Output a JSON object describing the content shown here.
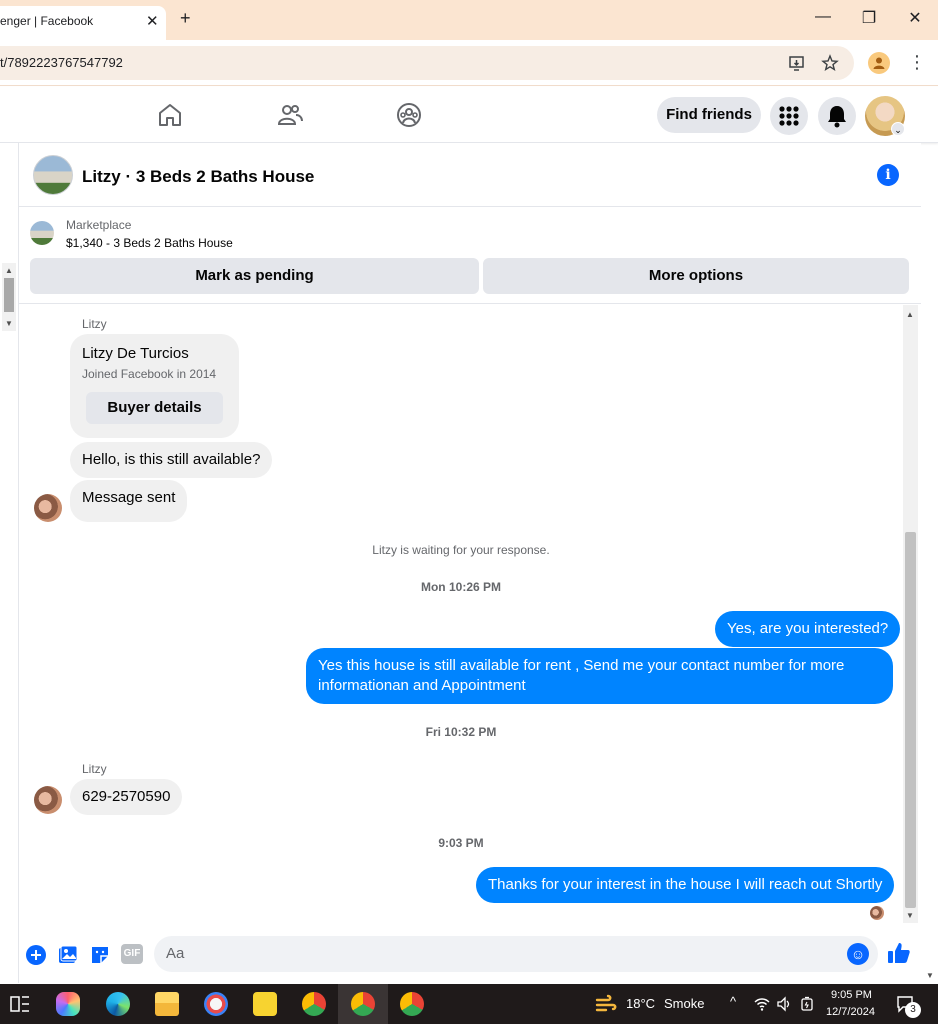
{
  "browser": {
    "tab_title": "enger | Facebook",
    "tab_close": "✕",
    "new_tab": "+",
    "url": "t/7892223767547792",
    "minimize": "—",
    "restore": "❐",
    "close": "✕"
  },
  "nav": {
    "find_friends": "Find friends"
  },
  "chat": {
    "title": "Litzy · 3 Beds 2 Baths House",
    "info": "i"
  },
  "marketplace": {
    "label": "Marketplace",
    "listing": "$1,340 - 3 Beds 2 Baths House",
    "mark_pending": "Mark as pending",
    "more_options": "More options"
  },
  "messages": {
    "sender1": "Litzy",
    "profile_name": "Litzy De Turcios",
    "profile_joined": "Joined Facebook in 2014",
    "buyer_details": "Buyer details",
    "msg1": "Hello, is this still available?",
    "msg2": "Message sent",
    "waiting": "Litzy is waiting for your response.",
    "ts1": "Mon 10:26 PM",
    "out1": "Yes, are you interested?",
    "out2": "Yes this house is still available for rent , Send me your contact number for more informationan and Appointment",
    "ts2": "Fri 10:32 PM",
    "sender2": "Litzy",
    "msg3": "629-2570590",
    "ts3": "9:03 PM",
    "out3": "Thanks for your interest in the house I will reach out Shortly"
  },
  "composer": {
    "placeholder": "Aa",
    "gif": "GIF"
  },
  "taskbar": {
    "weather_temp": "18°C",
    "weather_desc": "Smoke",
    "time": "9:05 PM",
    "date": "12/7/2024",
    "notifications": "3"
  },
  "colors": {
    "accent": "#0866ff",
    "outgoing_bubble": "#0084ff",
    "incoming_bubble": "#f0f0f0",
    "tab_bar": "#fbe5d1",
    "taskbar": "#1f1a1a"
  }
}
